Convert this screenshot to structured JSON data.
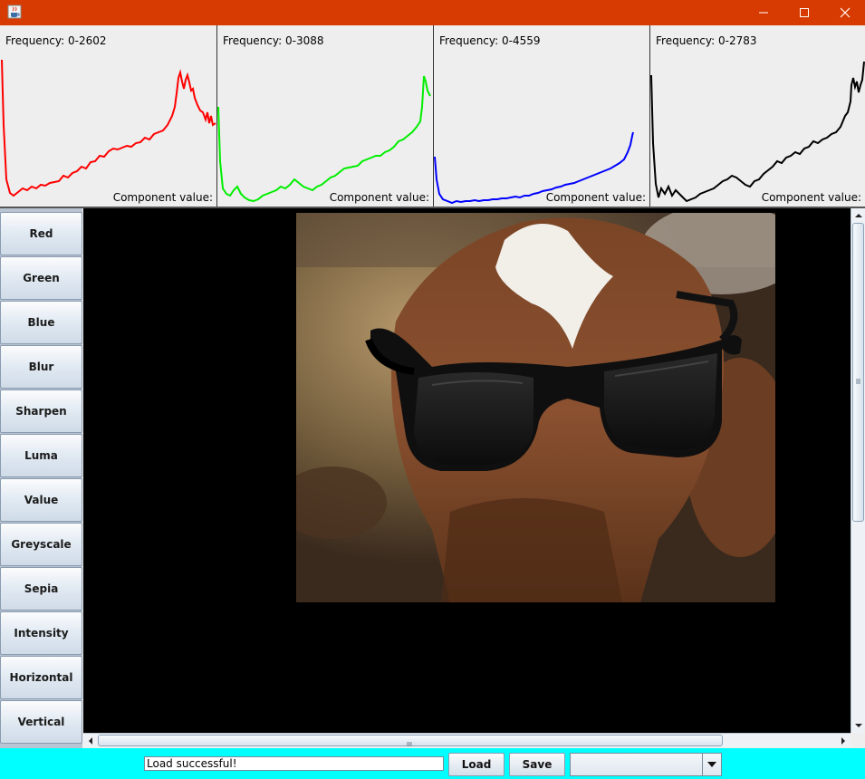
{
  "window": {
    "app_icon": "java-cup-icon",
    "controls": [
      "minimize-icon",
      "maximize-icon",
      "close-icon"
    ],
    "titlebar_color": "#d83b01"
  },
  "histograms": [
    {
      "freq_label": "Frequency: 0-2602",
      "axis_label": "Component value:",
      "color": "#ff0000"
    },
    {
      "freq_label": "Frequency: 0-3088",
      "axis_label": "Component value:",
      "color": "#00ee00"
    },
    {
      "freq_label": "Frequency: 0-4559",
      "axis_label": "Component value:",
      "color": "#0000ff"
    },
    {
      "freq_label": "Frequency: 0-2783",
      "axis_label": "Component value:",
      "color": "#000000"
    }
  ],
  "filters": [
    "Red",
    "Green",
    "Blue",
    "Blur",
    "Sharpen",
    "Luma",
    "Value",
    "Greyscale",
    "Sepia",
    "Intensity",
    "Horizontal",
    "Vertical"
  ],
  "image": {
    "description_icon": "image-canvas"
  },
  "bottom": {
    "status_text": "Load successful!",
    "load_label": "Load",
    "save_label": "Save",
    "combo_value": ""
  },
  "colors": {
    "bottom_bar": "#00ffff",
    "viewport": "#000000"
  }
}
